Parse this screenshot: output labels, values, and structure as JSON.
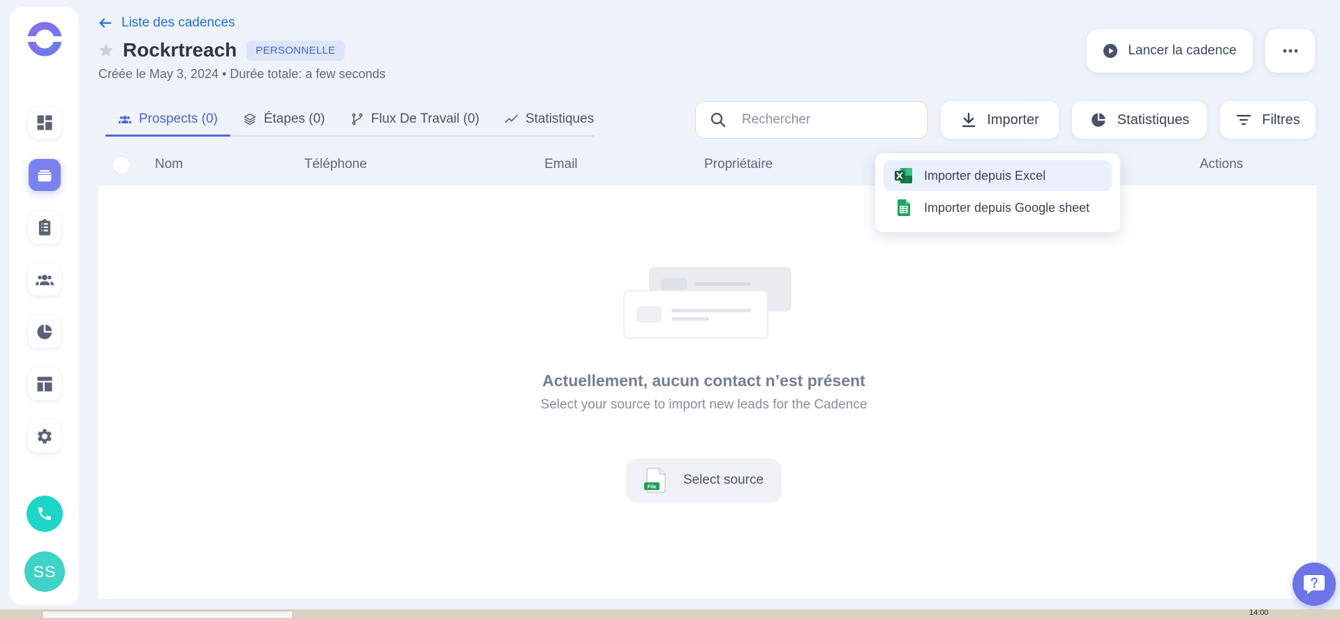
{
  "header": {
    "back_label": "Liste des cadences",
    "title": "Rockrtreach",
    "badge": "PERSONNELLE",
    "subtitle": "Créée le May 3, 2024 • Durée totale: a few seconds",
    "launch_label": "Lancer la cadence"
  },
  "tabs": [
    {
      "label": "Prospects (0)",
      "icon": "users-icon",
      "active": true
    },
    {
      "label": "Étapes (0)",
      "icon": "layers-icon",
      "active": false
    },
    {
      "label": "Flux De Travail (0)",
      "icon": "workflow-icon",
      "active": false
    },
    {
      "label": "Statistiques",
      "icon": "trend-icon",
      "active": false
    }
  ],
  "toolbar": {
    "search_placeholder": "Rechercher",
    "import_label": "Importer",
    "stats_label": "Statistiques",
    "filters_label": "Filtres"
  },
  "table": {
    "columns": [
      "Nom",
      "Téléphone",
      "Email",
      "Propriétaire",
      "Actions"
    ]
  },
  "import_menu": {
    "items": [
      {
        "label": "Importer depuis Excel",
        "icon": "excel-icon"
      },
      {
        "label": "Importer depuis Google sheet",
        "icon": "google-sheets-icon"
      }
    ]
  },
  "empty_state": {
    "title": "Actuellement, aucun contact n’est présent",
    "subtitle": "Select your source to import new leads for the Cadence",
    "button_label": "Select source",
    "file_badge": "File"
  },
  "user": {
    "initials": "SS"
  },
  "taskbar": {
    "clock": "14:00"
  },
  "colors": {
    "accent": "#5465db",
    "link": "#1f6fd6",
    "teal": "#1ed6c8",
    "background": "#eef3fa"
  }
}
